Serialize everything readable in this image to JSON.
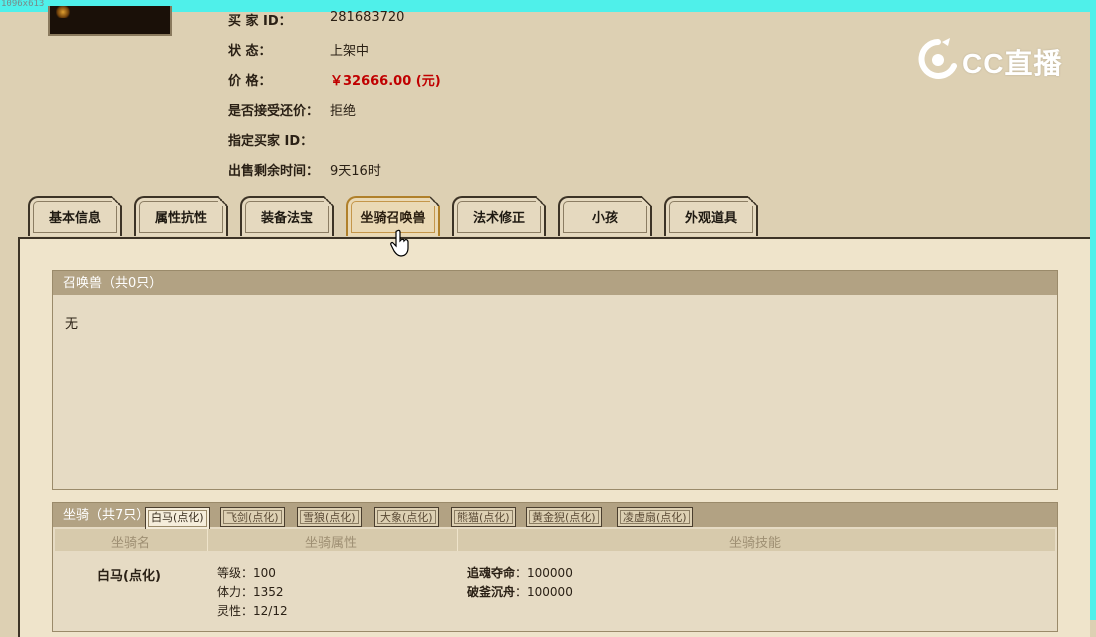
{
  "screen": {
    "size_label": "1096x613"
  },
  "seller": {
    "buyer_id_label": "买  家  ID：",
    "buyer_id_value": "281683720",
    "status_label": "状       态：",
    "status_value": "上架中",
    "price_label": "价       格：",
    "price_value": "￥32666.00 (元)",
    "counteroffer_label": "是否接受还价：",
    "counteroffer_value": "拒绝",
    "designated_buyer_label": "指定买家 ID：",
    "designated_buyer_value": "",
    "remaining_time_label": "出售剩余时间：",
    "remaining_time_value": "9天16时"
  },
  "logo": {
    "text": "CC直播",
    "icon": "cc-logo-icon"
  },
  "tabs": [
    {
      "label": "基本信息"
    },
    {
      "label": "属性抗性"
    },
    {
      "label": "装备法宝"
    },
    {
      "label": "坐骑召唤兽",
      "active": true
    },
    {
      "label": "法术修正"
    },
    {
      "label": "小孩"
    },
    {
      "label": "外观道具"
    }
  ],
  "pets": {
    "header": "召唤兽（共0只）",
    "empty_text": "无"
  },
  "mounts": {
    "header": "坐骑（共7只）",
    "tabs": [
      {
        "label": "白马(点化)",
        "active": true
      },
      {
        "label": "飞剑(点化)"
      },
      {
        "label": "雪狼(点化)"
      },
      {
        "label": "大象(点化)"
      },
      {
        "label": "熊猫(点化)"
      },
      {
        "label": "黄金猊(点化)"
      },
      {
        "label": "凌虚扇(点化)"
      }
    ],
    "columns": {
      "name": "坐骑名",
      "attributes": "坐骑属性",
      "skills": "坐骑技能"
    },
    "current": {
      "name": "白马(点化)",
      "attributes": [
        "等级：100",
        "体力：1352",
        "灵性：12/12"
      ],
      "skills": [
        {
          "name": "追魂夺命",
          "value": "：100000"
        },
        {
          "name": "破釜沉舟",
          "value": "：100000"
        }
      ]
    }
  },
  "colors": {
    "background": "#ddd0b3",
    "panel_header": "#b2a283",
    "price": "#c00000",
    "accent_bar": "#4ff0ea"
  }
}
